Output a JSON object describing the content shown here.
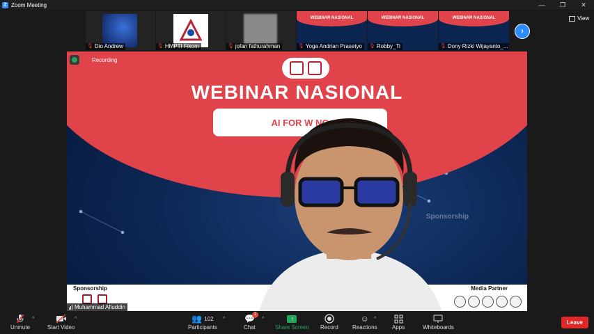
{
  "window": {
    "title": "Zoom Meeting"
  },
  "view_label": "View",
  "participants_strip": [
    {
      "name": "Dio Andrew"
    },
    {
      "name": "HMPTI Fikom"
    },
    {
      "name": "jofan fathurahman"
    },
    {
      "name": "Yoga Andrian Prasetyo"
    },
    {
      "name": "Robby_Ti"
    },
    {
      "name": "Dony Rizki Wijayanto_..."
    }
  ],
  "thumb_slide_title": "WEBINAR NASIONAL",
  "recording_label": "Recording",
  "slide": {
    "title": "WEBINAR NASIONAL",
    "subtitle": "AI FOR W                NG",
    "watermark": "Sponsorship",
    "sponsorship_label": "Sponsorship",
    "media_partner_label": "Media Partner"
  },
  "active_speaker": "Muhammad Afiuddin",
  "toolbar": {
    "unmute": "Unmute",
    "start_video": "Start Video",
    "participants": "Participants",
    "participants_count": "102",
    "chat": "Chat",
    "chat_badge": "1",
    "share_screen": "Share Screen",
    "record": "Record",
    "reactions": "Reactions",
    "apps": "Apps",
    "whiteboards": "Whiteboards",
    "leave": "Leave"
  },
  "colors": {
    "accent": "#2d8cff",
    "leave": "#e02828",
    "share": "#23a55a",
    "slide_red": "#e0434a"
  }
}
